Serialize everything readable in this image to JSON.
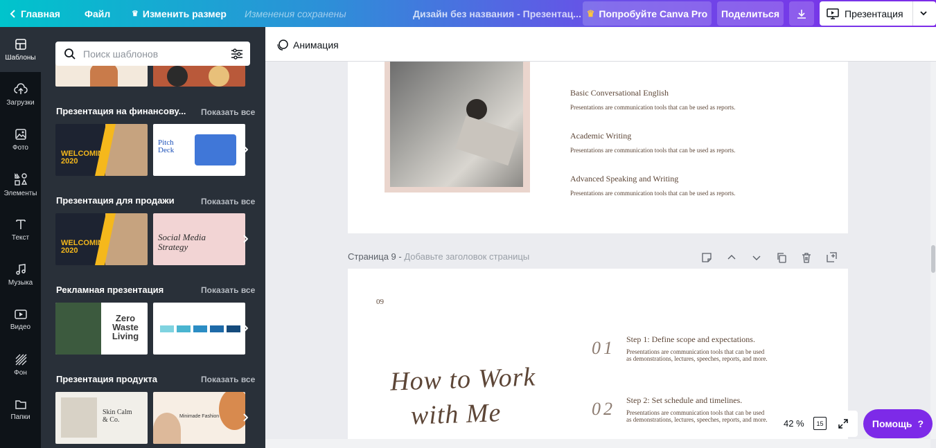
{
  "topbar": {
    "home_label": "Главная",
    "file_label": "Файл",
    "resize_label": "Изменить размер",
    "saved_status": "Изменения сохранены",
    "doc_title": "Дизайн без названия - Презентац...",
    "try_pro_label": "Попробуйте Canva Pro",
    "share_label": "Поделиться",
    "present_label": "Презентация"
  },
  "rail": {
    "items": [
      {
        "label": "Шаблоны",
        "icon": "templates-icon"
      },
      {
        "label": "Загрузки",
        "icon": "upload-cloud-icon"
      },
      {
        "label": "Фото",
        "icon": "photo-icon"
      },
      {
        "label": "Элементы",
        "icon": "elements-icon"
      },
      {
        "label": "Текст",
        "icon": "text-icon"
      },
      {
        "label": "Музыка",
        "icon": "music-icon"
      },
      {
        "label": "Видео",
        "icon": "video-icon"
      },
      {
        "label": "Фон",
        "icon": "background-icon"
      },
      {
        "label": "Папки",
        "icon": "folder-icon"
      }
    ]
  },
  "panel": {
    "search_placeholder": "Поиск шаблонов",
    "show_all": "Показать все",
    "sections": [
      {
        "title": "Презентация на финансову...",
        "thumbs": [
          {
            "line1": "WELCOMING",
            "line2": "2020"
          },
          {
            "line1": "Pitch",
            "line2": "Deck"
          }
        ]
      },
      {
        "title": "Презентация для продажи",
        "thumbs": [
          {
            "line1": "WELCOMING",
            "line2": "2020"
          },
          {
            "line1": "Social Media",
            "line2": "Strategy"
          }
        ]
      },
      {
        "title": "Рекламная презентация",
        "thumbs": [
          {
            "line1": "Zero",
            "line2": "Waste",
            "line3": "Living"
          },
          {
            "line1": "",
            "line2": ""
          }
        ]
      },
      {
        "title": "Презентация продукта",
        "thumbs": [
          {
            "line1": "Skin Calm",
            "line2": "& Co."
          },
          {
            "line1": "Minimade Fashion",
            "line2": ""
          }
        ]
      }
    ]
  },
  "editor": {
    "animation_label": "Анимация",
    "page8": {
      "items": [
        {
          "title": "Basic Conversational English",
          "desc": "Presentations are communication tools that can be used as reports."
        },
        {
          "title": "Academic Writing",
          "desc": "Presentations are communication tools that can be used as reports."
        },
        {
          "title": "Advanced Speaking and Writing",
          "desc": "Presentations are communication tools that can be used as reports."
        }
      ]
    },
    "page9": {
      "header": "Страница 9 -",
      "header_hint": "Добавьте заголовок страницы",
      "number": "09",
      "script_line1": "How to Work",
      "script_line2": "with Me",
      "steps": [
        {
          "num": "01",
          "title": "Step 1: Define scope and expectations.",
          "desc1": "Presentations are communication tools that can be used",
          "desc2": "as demonstrations, lectures, speeches, reports, and more."
        },
        {
          "num": "02",
          "title": "Step 2: Set schedule and timelines.",
          "desc1": "Presentations are communication tools that can be used",
          "desc2": "as demonstrations, lectures, speeches, reports, and more."
        }
      ]
    }
  },
  "bottom": {
    "zoom": "42 %",
    "page_count": "15",
    "help_label": "Помощь",
    "help_icon": "?"
  },
  "colors": {
    "brand_purple": "#7d2ae8",
    "brand_teal": "#00c4cc",
    "sidebar_dark": "#0e1318",
    "panel_dark": "#293039"
  }
}
